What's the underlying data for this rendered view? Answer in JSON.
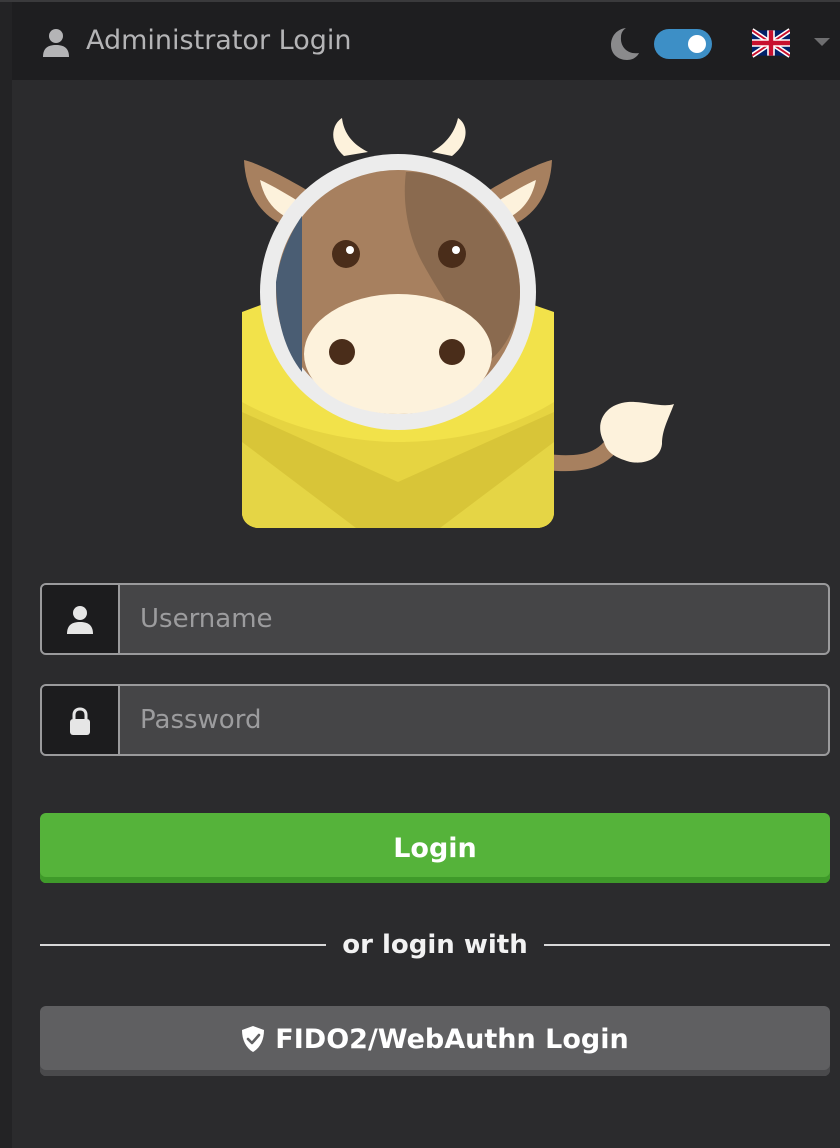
{
  "header": {
    "title": "Administrator Login",
    "user_icon": "user-icon",
    "theme_icon": "moon-icon",
    "theme_toggle_on": true,
    "language_icon": "uk-flag-icon",
    "language_caret_icon": "caret-down-icon"
  },
  "logo": {
    "icon": "cow-mail-logo"
  },
  "form": {
    "username": {
      "icon": "user-icon",
      "placeholder": "Username",
      "value": ""
    },
    "password": {
      "icon": "lock-icon",
      "placeholder": "Password",
      "value": ""
    },
    "login_label": "Login",
    "divider_label": "or login with",
    "fido_label": "FIDO2/WebAuthn Login",
    "fido_icon": "shield-check-icon"
  },
  "colors": {
    "background": "#2b2b2d",
    "header_background": "#1e1e20",
    "toggle": "#3d8fc6",
    "login_button": "#55b33a",
    "fido_button": "#5f5f61",
    "input_background": "#454547",
    "input_border": "#9a9a9c"
  }
}
